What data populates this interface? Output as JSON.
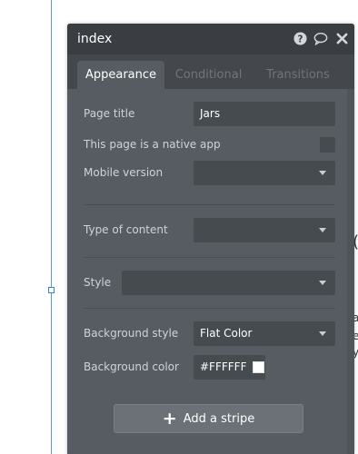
{
  "panel": {
    "title": "index",
    "icons": {
      "help": "help-icon",
      "comment": "comment-icon",
      "close": "close-icon"
    }
  },
  "tabs": [
    {
      "label": "Appearance",
      "active": true
    },
    {
      "label": "Conditional",
      "active": false
    },
    {
      "label": "Transitions",
      "active": false
    }
  ],
  "fields": {
    "page_title_label": "Page title",
    "page_title_value": "Jars",
    "native_app_label": "This page is a native app",
    "native_app_checked": false,
    "mobile_version_label": "Mobile version",
    "mobile_version_value": "",
    "type_of_content_label": "Type of content",
    "type_of_content_value": "",
    "style_label": "Style",
    "style_value": "",
    "background_style_label": "Background style",
    "background_style_value": "Flat Color",
    "background_color_label": "Background color",
    "background_color_value": "#FFFFFF"
  },
  "buttons": {
    "add_stripe_label": "Add a stripe"
  },
  "colors": {
    "panel_bg": "#565c62",
    "header_bg": "#3a3e43",
    "field_bg": "#464b50",
    "selection_guide": "#5b9bd5",
    "swatch": "#FFFFFF"
  },
  "background_text": {
    "frag1": "(",
    "frag2": "a",
    "frag3": "e",
    "frag4": "y"
  }
}
